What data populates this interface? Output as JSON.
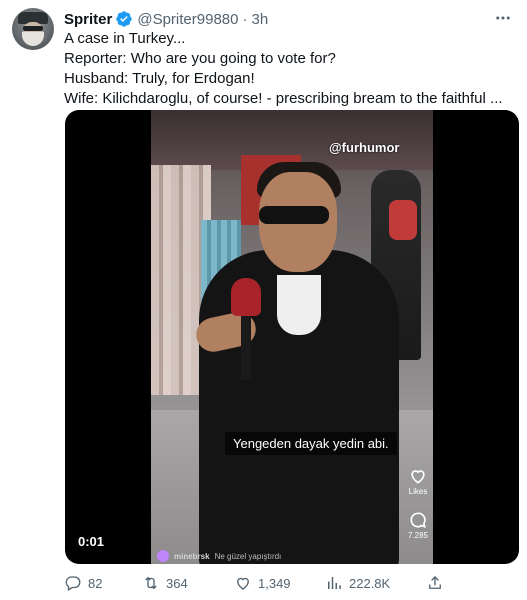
{
  "tweet": {
    "author_name": "Spriter",
    "author_handle": "@Spriter99880",
    "separator": "·",
    "time": "3h",
    "lines": [
      "A case in Turkey...",
      "Reporter: Who are you going to vote for?",
      "Husband: Truly, for Erdogan!",
      "Wife: Kilichdaroglu, of course! - prescribing bream to the faithful ..."
    ]
  },
  "video": {
    "watermark": "@furhumor",
    "caption": "Yengeden dayak yedin abi.",
    "timestamp": "0:01",
    "side_likes_label": "Likes",
    "side_comments_count": "7.285",
    "comment_user": "minebrsk",
    "comment_text": "Ne güzel yapıştırdı"
  },
  "actions": {
    "replies": "82",
    "retweets": "364",
    "likes": "1,349",
    "views": "222.8K"
  },
  "colors": {
    "verified": "#1d9bf0",
    "text": "#0f1419",
    "secondary": "#536471"
  },
  "icons": [
    "verified-badge-icon",
    "more-options-icon",
    "reply-icon",
    "retweet-icon",
    "like-icon",
    "views-icon",
    "share-icon"
  ]
}
